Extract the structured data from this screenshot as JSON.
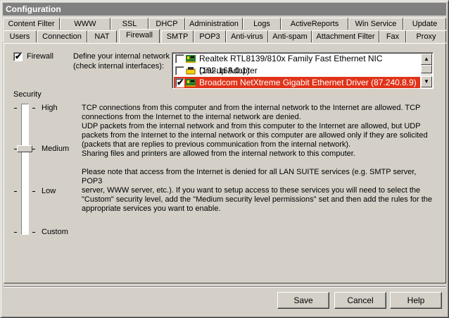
{
  "window": {
    "title": "Configuration"
  },
  "tabs_row1": [
    "Content Filter",
    "WWW",
    "SSL",
    "DHCP",
    "Administration",
    "Logs",
    "ActiveReports",
    "Win Service",
    "Update"
  ],
  "tabs_row2": [
    "Users",
    "Connection",
    "NAT",
    "Firewall",
    "SMTP",
    "POP3",
    "Anti-virus",
    "Anti-spam",
    "Attachment Filter",
    "Fax",
    "Proxy"
  ],
  "active_tab": "Firewall",
  "firewall": {
    "label": "Firewall",
    "checked": true
  },
  "network": {
    "label_line1": "Define your internal network",
    "label_line2": "(check internal interfaces):",
    "interfaces": [
      {
        "name": "Realtek RTL8139/810x Family Fast Ethernet NIC (192.168.0.1)",
        "checked": false,
        "icon": "network-card-icon"
      },
      {
        "name": "Dial-up Adapter",
        "checked": false,
        "icon": "dialup-icon"
      },
      {
        "name": "Broadcom NetXtreme Gigabit Ethernet Driver (87.240.8.9)",
        "checked": true,
        "icon": "network-card-icon",
        "selected": true
      }
    ]
  },
  "security": {
    "label": "Security",
    "levels": [
      "High",
      "Medium",
      "Low",
      "Custom"
    ],
    "current": "Medium"
  },
  "description": {
    "para1": "TCP connections from this computer and from the internal network to the Internet are allowed. TCP\nconnections from the Internet to the internal network are denied.\nUDP packets from the internal network and from this computer to the Internet are allowed, but UDP\npackets from the Internet to the internal network or this computer are allowed only if they are solicited\n(packets that are replies to previous communication from the internal network).\nSharing files and printers are allowed from the internal network to this computer.",
    "para2": "Please note that access from the Internet is denied for all LAN SUITE services (e.g. SMTP server, POP3\nserver, WWW server, etc.). If you want to setup access to these services you will need to select the\n\"Custom\" security level, add the \"Medium security level permissions\" set and then add the rules for the\nappropriate services you want to enable."
  },
  "buttons": {
    "save": "Save",
    "cancel": "Cancel",
    "help": "Help"
  },
  "colors": {
    "selection": "#e0331a",
    "face": "#d4d0c8",
    "titlebar": "#808080"
  }
}
